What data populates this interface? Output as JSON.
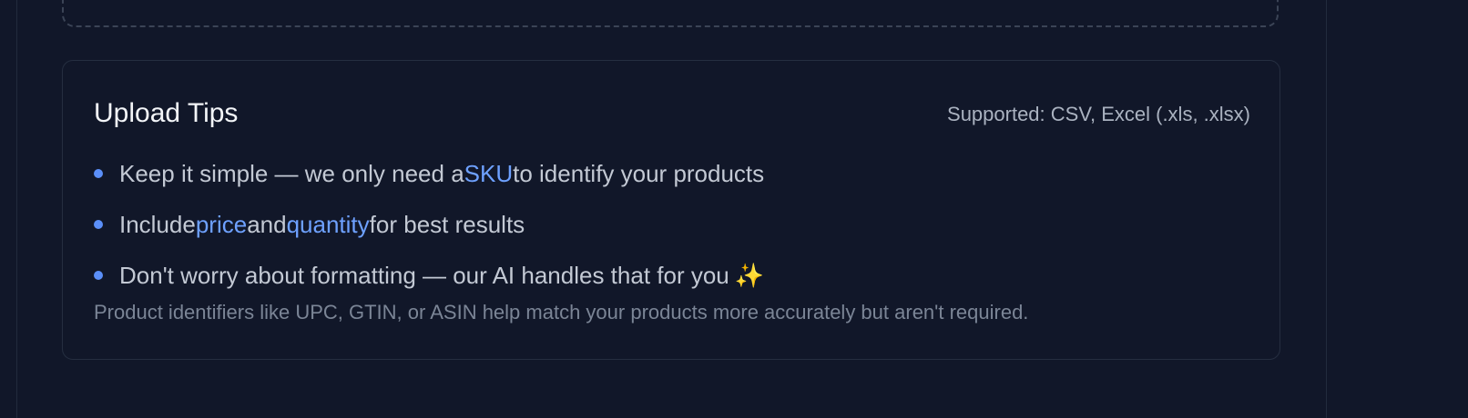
{
  "tips": {
    "title": "Upload Tips",
    "supported": "Supported: CSV, Excel (.xls, .xlsx)",
    "items": [
      {
        "parts": [
          {
            "text": "Keep it simple — we only need a",
            "hl": false
          },
          {
            "text": "SKU",
            "hl": true
          },
          {
            "text": "to identify your products",
            "hl": false
          }
        ]
      },
      {
        "parts": [
          {
            "text": "Include",
            "hl": false
          },
          {
            "text": "price",
            "hl": true
          },
          {
            "text": "and",
            "hl": false
          },
          {
            "text": "quantity",
            "hl": true
          },
          {
            "text": "for best results",
            "hl": false
          }
        ]
      },
      {
        "parts": [
          {
            "text": "Don't worry about formatting — our AI handles that for you",
            "hl": false
          },
          {
            "text": "✨",
            "hl": false
          }
        ]
      }
    ],
    "footnote": "Product identifiers like UPC, GTIN, or ASIN help match your products more accurately but aren't required."
  },
  "colors": {
    "background": "#111729",
    "accent": "#6ea1ff",
    "bullet": "#5b8ff9"
  },
  "icons": {
    "bullet": "bullet-dot-icon",
    "sparkle": "sparkle-icon"
  }
}
